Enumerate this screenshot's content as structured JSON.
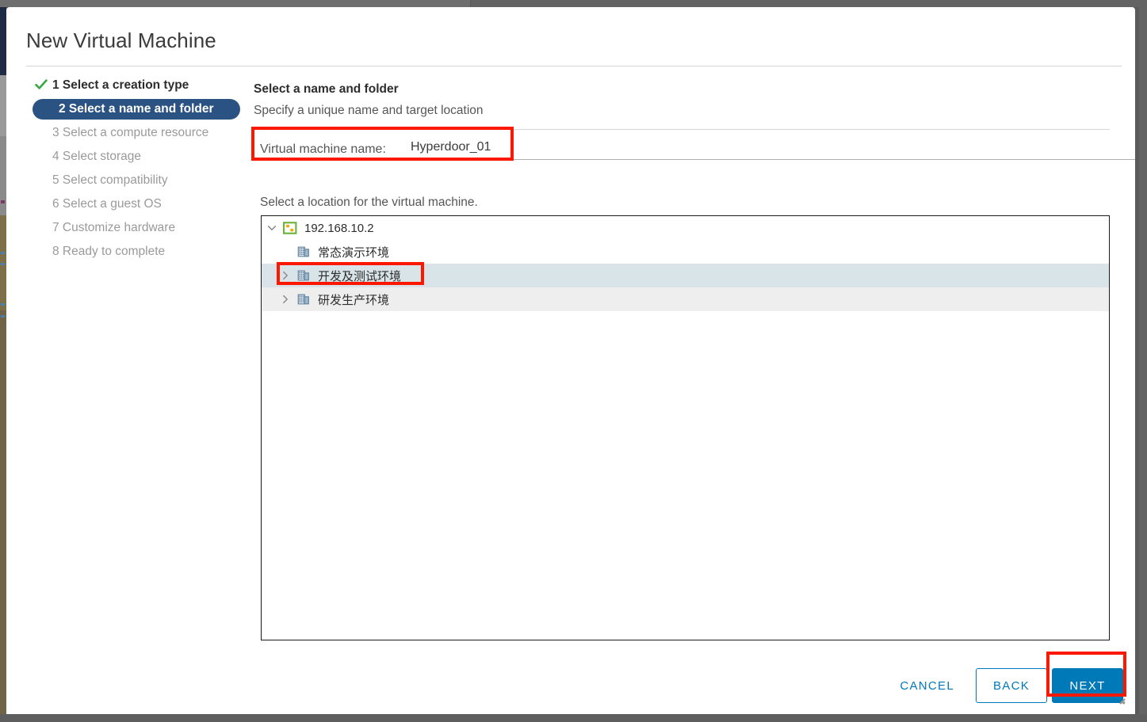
{
  "dialog": {
    "title": "New Virtual Machine"
  },
  "steps": [
    {
      "label": "1 Select a creation type",
      "state": "done",
      "icon": "check-icon"
    },
    {
      "label": "2 Select a name and folder",
      "state": "active",
      "icon": ""
    },
    {
      "label": "3 Select a compute resource",
      "state": "todo",
      "icon": ""
    },
    {
      "label": "4 Select storage",
      "state": "todo",
      "icon": ""
    },
    {
      "label": "5 Select compatibility",
      "state": "todo",
      "icon": ""
    },
    {
      "label": "6 Select a guest OS",
      "state": "todo",
      "icon": ""
    },
    {
      "label": "7 Customize hardware",
      "state": "todo",
      "icon": ""
    },
    {
      "label": "8 Ready to complete",
      "state": "todo",
      "icon": ""
    }
  ],
  "pane": {
    "title": "Select a name and folder",
    "subtitle": "Specify a unique name and target location",
    "name_label": "Virtual machine name:",
    "name_value": "Hyperdoor_01",
    "name_placeholder": "",
    "location_label": "Select a location for the virtual machine."
  },
  "tree": [
    {
      "label": "192.168.10.2",
      "icon": "vcenter-icon",
      "twisty": "chevron-down-icon",
      "depth": 0,
      "state": "normal"
    },
    {
      "label": "常态演示环境",
      "icon": "datacenter-icon",
      "twisty": "",
      "depth": 1,
      "state": "normal"
    },
    {
      "label": "开发及测试环境",
      "icon": "datacenter-icon",
      "twisty": "chevron-right-icon",
      "depth": 1,
      "state": "selected"
    },
    {
      "label": "研发生产环境",
      "icon": "datacenter-icon",
      "twisty": "chevron-right-icon",
      "depth": 1,
      "state": "zebra"
    }
  ],
  "footer": {
    "cancel_label": "CANCEL",
    "back_label": "BACK",
    "next_label": "NEXT"
  },
  "colors": {
    "accent_blue": "#0079b8",
    "active_step_blue": "#2a5283",
    "selected_row": "#d9e4e8",
    "zebra_row": "#eeeeee",
    "annotation_red": "#fb1700",
    "check_green": "#3aa847"
  }
}
